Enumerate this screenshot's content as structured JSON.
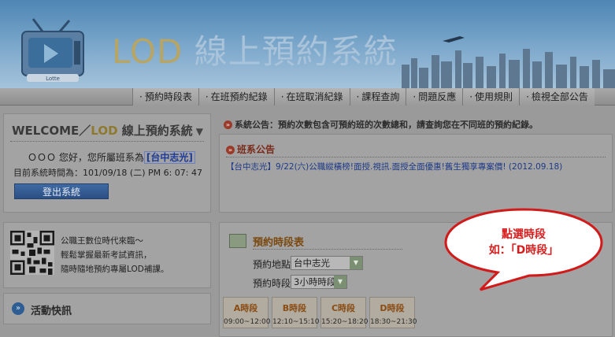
{
  "header": {
    "brand_lod": "LOD",
    "brand_rest": " 線上預約系統",
    "tv_label": "Lotte"
  },
  "tabs": [
    "預約時段表",
    "在班預約紀錄",
    "在班取消紀錄",
    "課程查詢",
    "問題反應",
    "使用規則",
    "檢視全部公告"
  ],
  "welcome": {
    "prefix": "WELCOME／",
    "lod": "LOD",
    "suffix": " 線上預約系統",
    "triangle": "▼",
    "user_text": "ＯＯＯ 您好，您所屬班系為",
    "class_name": "[台中志光]",
    "time_text": "目前系統時間為：101/09/18 (二) PM 6: 07: 47",
    "logout_label": "登出系統"
  },
  "qr": {
    "lines": [
      "公職王數位時代來臨～",
      "輕鬆掌握最新考試資訊，",
      "隨時隨地預約專屬LOD補課。"
    ]
  },
  "news": {
    "title": "活動快訊",
    "icon_glyph": "»"
  },
  "system_notice": {
    "icon_glyph": "»",
    "text": "系統公告：預約次數包含可預約班的次數總和，請查詢您在不同班的預約紀錄。"
  },
  "announcement": {
    "icon_glyph": "»",
    "title": "班系公告",
    "item": "【台中志光】9/22(六)公職縱橫榜!面授.視訊.面授全面優惠!舊生獨享專案價! (2012.09.18)"
  },
  "booking": {
    "title": "預約時段表",
    "location_label": "預約地點",
    "location_value": "台中志光",
    "duration_label": "預約時段",
    "duration_value": "3小時時段",
    "dropdown_glyph": "▼",
    "slots": [
      {
        "name": "A時段",
        "time": "09:00~12:00"
      },
      {
        "name": "B時段",
        "time": "12:10~15:10"
      },
      {
        "name": "C時段",
        "time": "15:20~18:20"
      },
      {
        "name": "D時段",
        "time": "18:30~21:30"
      }
    ]
  },
  "callout": {
    "line1": "點選時段",
    "line2": "如：「D時段」"
  },
  "colors": {
    "callout_text": "#d61e1e",
    "callout_border": "#d11a1a",
    "accent_blue": "#2b4f84",
    "slot_name": "#8a4c12"
  }
}
